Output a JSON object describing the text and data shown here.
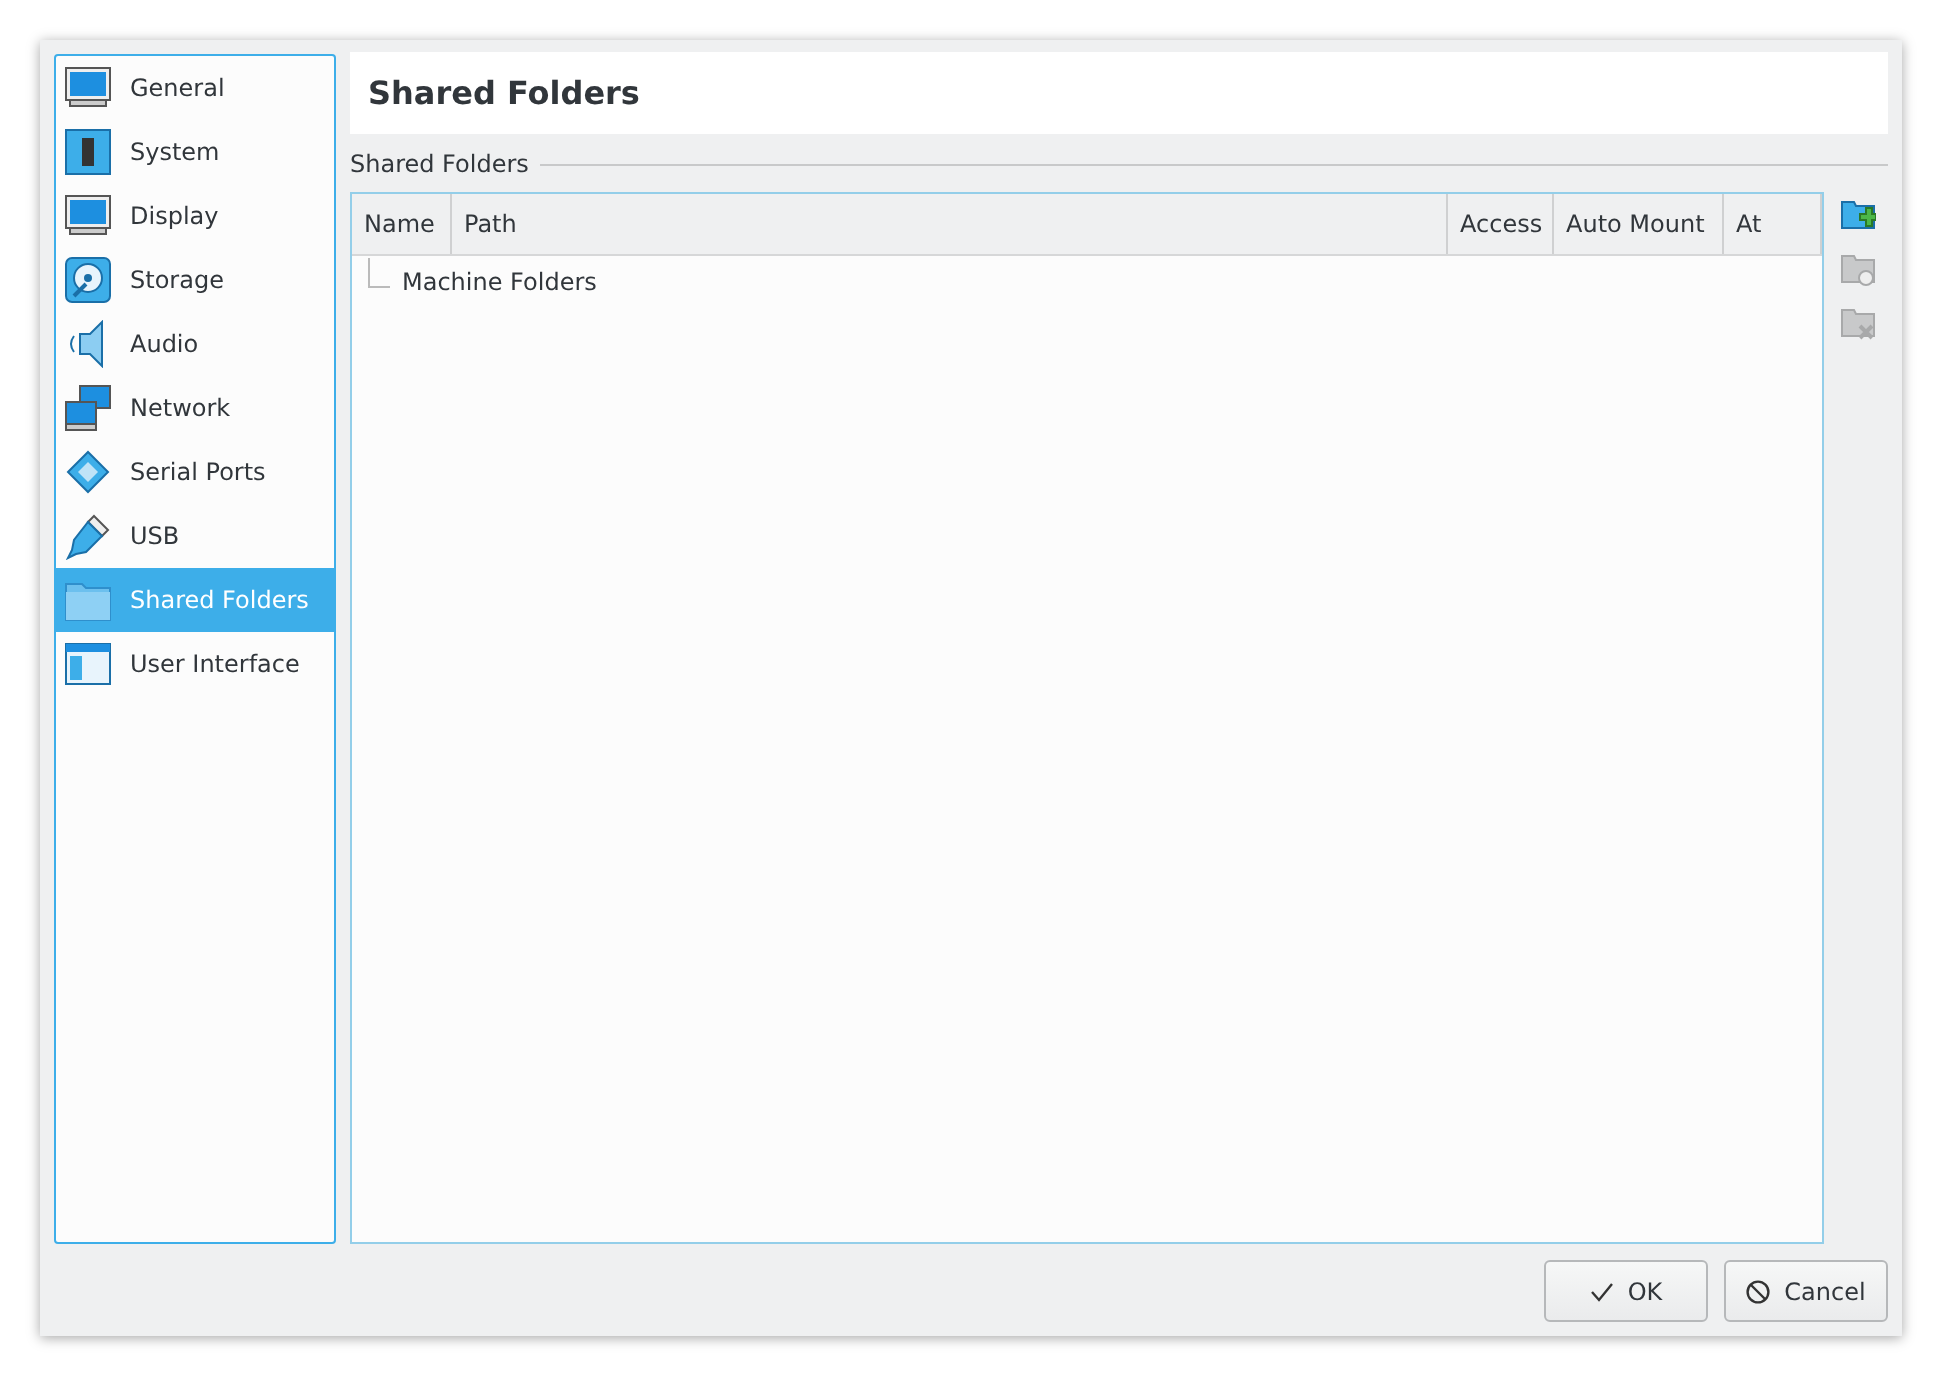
{
  "sidebar": {
    "items": [
      {
        "label": "General",
        "kind": "monitor",
        "selected": false
      },
      {
        "label": "System",
        "kind": "chip",
        "selected": false
      },
      {
        "label": "Display",
        "kind": "monitor",
        "selected": false
      },
      {
        "label": "Storage",
        "kind": "disk",
        "selected": false
      },
      {
        "label": "Audio",
        "kind": "speaker",
        "selected": false
      },
      {
        "label": "Network",
        "kind": "network",
        "selected": false
      },
      {
        "label": "Serial Ports",
        "kind": "serial",
        "selected": false
      },
      {
        "label": "USB",
        "kind": "usb",
        "selected": false
      },
      {
        "label": "Shared Folders",
        "kind": "folder",
        "selected": true
      },
      {
        "label": "User Interface",
        "kind": "window",
        "selected": false
      }
    ]
  },
  "page": {
    "title": "Shared Folders",
    "group_label": "Shared Folders",
    "table": {
      "columns": [
        "Name",
        "Path",
        "Access",
        "Auto Mount",
        "At"
      ],
      "rows": [
        {
          "name": "Machine Folders"
        }
      ]
    },
    "tools": [
      {
        "kind": "add",
        "disabled": false
      },
      {
        "kind": "edit",
        "disabled": true
      },
      {
        "kind": "remove",
        "disabled": true
      }
    ]
  },
  "buttons": [
    {
      "label": "OK",
      "kind": "ok"
    },
    {
      "label": "Cancel",
      "kind": "cancel"
    }
  ]
}
